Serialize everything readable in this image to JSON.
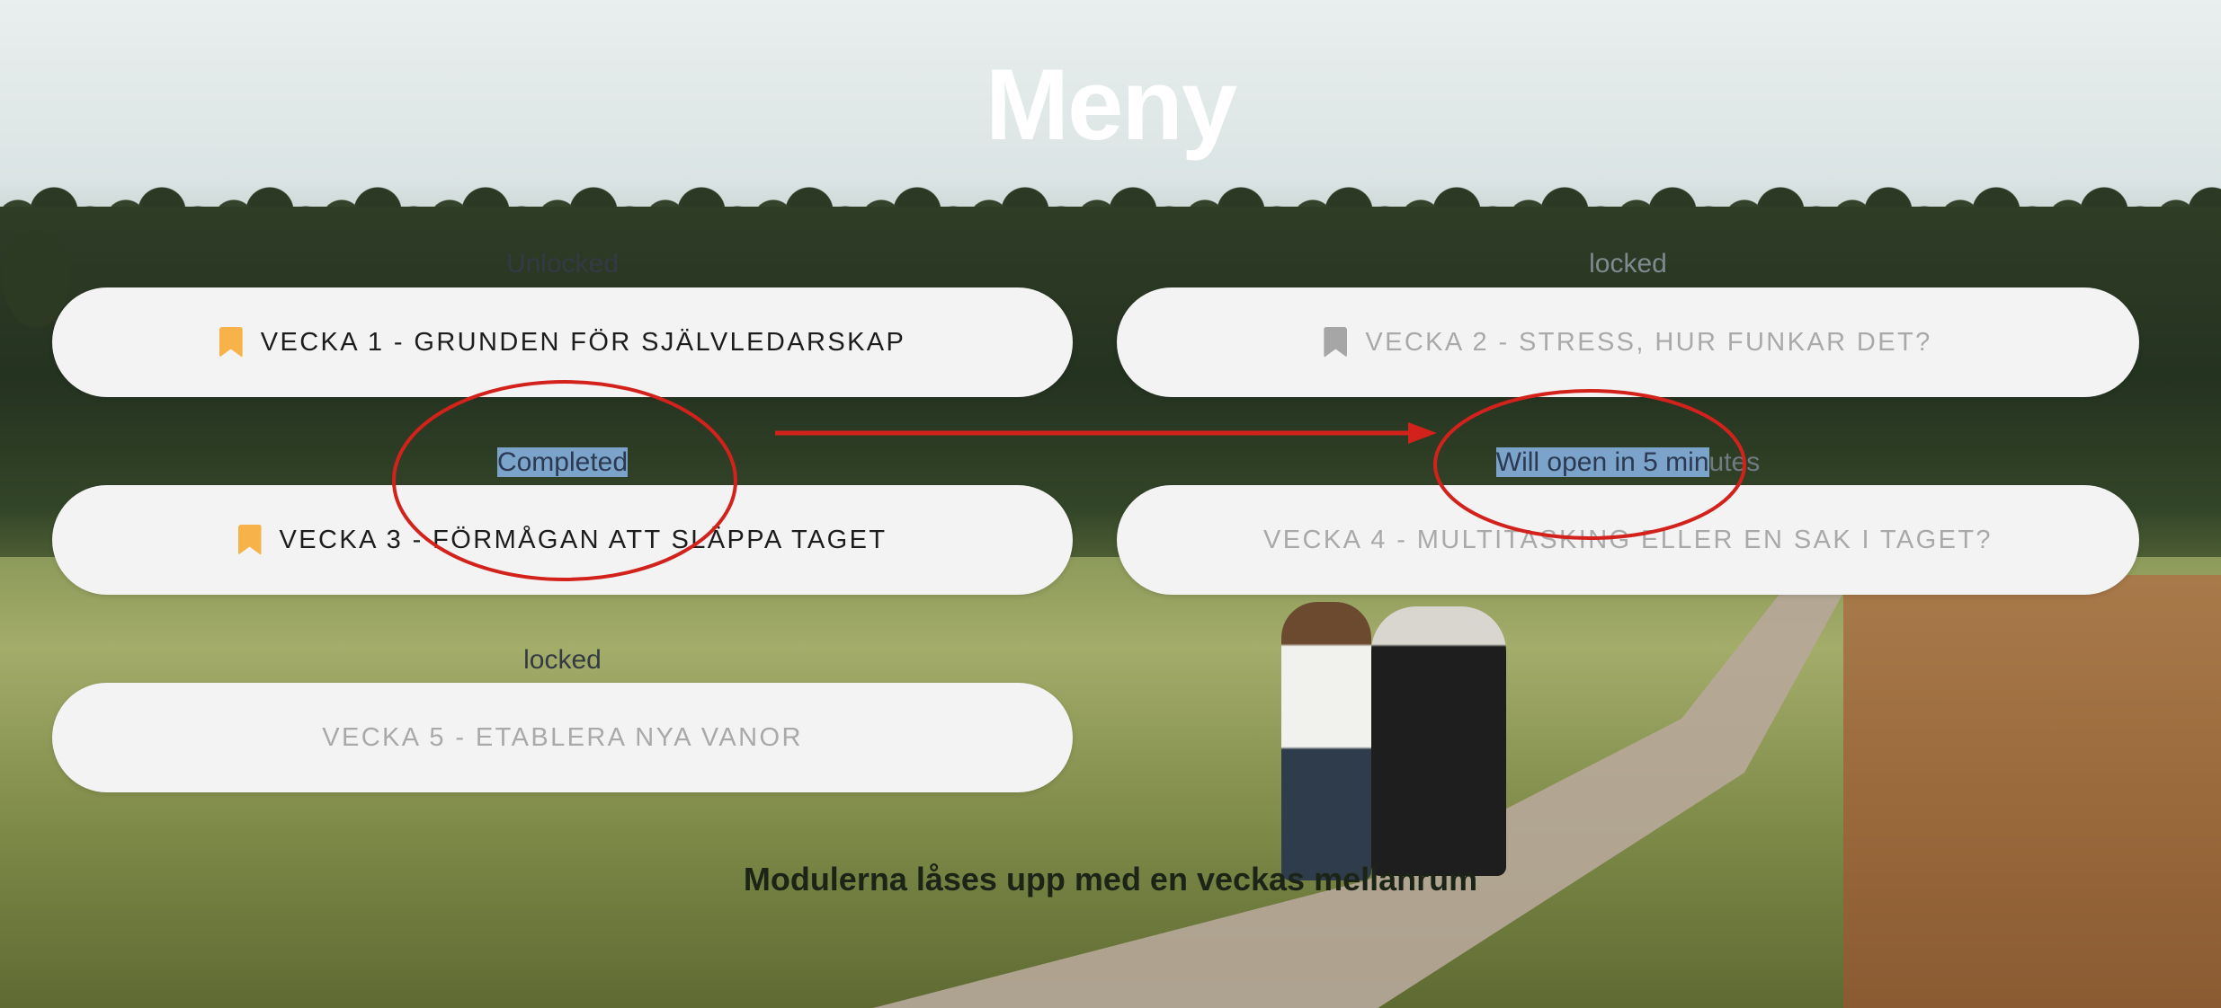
{
  "title": "Meny",
  "modules": [
    {
      "status": "Unlocked",
      "label": "VECKA 1 - GRUNDEN FÖR SJÄLVLEDARSKAP",
      "bookmark_color": "#f7b24a",
      "locked": false
    },
    {
      "status": "locked",
      "label": "VECKA 2 - STRESS, HUR FUNKAR DET?",
      "bookmark_color": "#a6a6a6",
      "locked": true
    },
    {
      "status": "Completed",
      "label": "VECKA 3 - FÖRMÅGAN ATT SLÄPPA TAGET",
      "bookmark_color": "#f7b24a",
      "locked": false
    },
    {
      "status": "Will open in 5 minutes",
      "label": "VECKA 4 - MULTITASKING ELLER EN SAK I TAGET?",
      "locked": true
    },
    {
      "status": "locked",
      "label": "VECKA 5 - ETABLERA NYA VANOR",
      "locked": true
    }
  ],
  "status_highlight_completed": "Completed",
  "status_highlight_open": "Will open in 5 min",
  "status_rest_open": "utes",
  "note": "Modulerna låses upp med en veckas mellanrum",
  "colors": {
    "card_bg": "#f3f3f3",
    "bookmark_active": "#f7b24a",
    "bookmark_inactive": "#a6a6a6",
    "annotation_red": "#d3211c",
    "selection_highlight": "#7ca3c9"
  }
}
